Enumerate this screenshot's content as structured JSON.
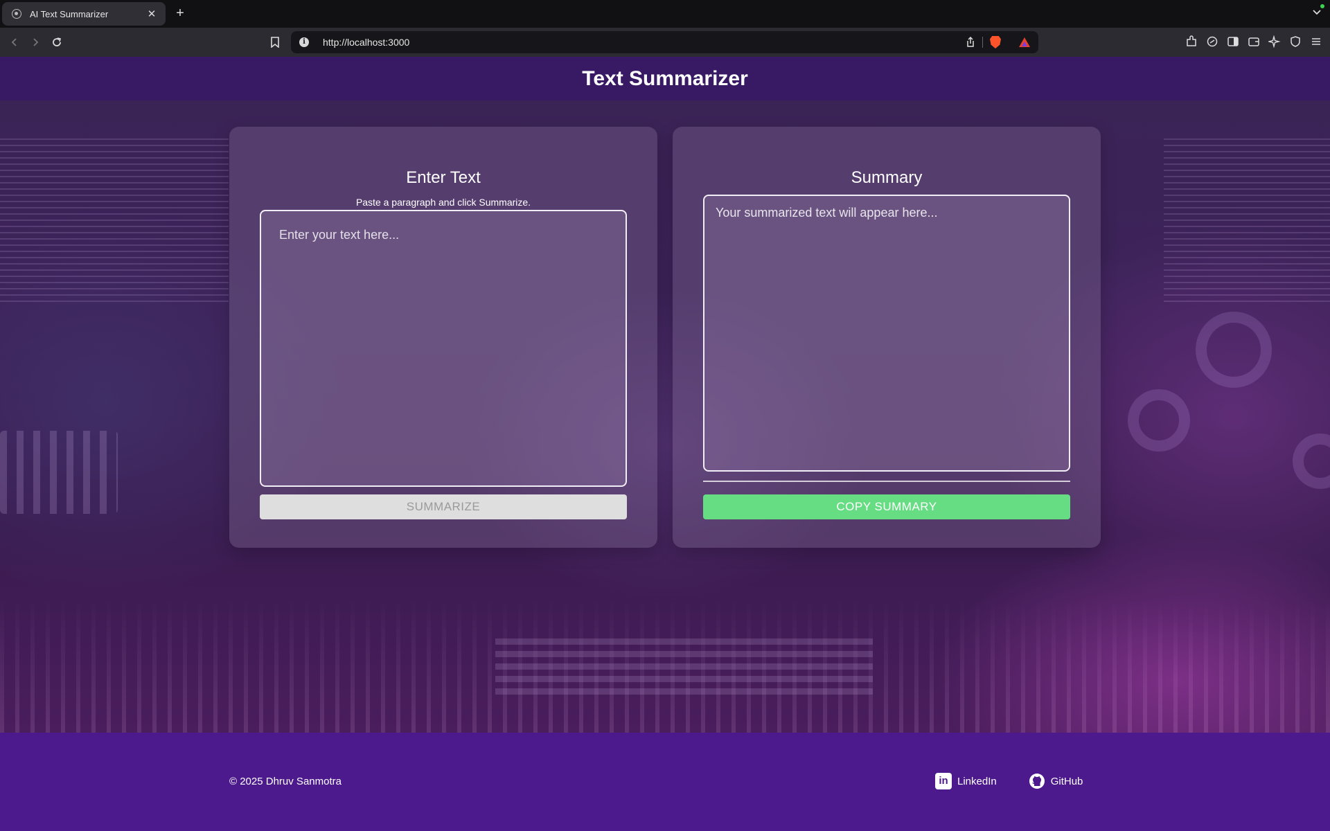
{
  "browser": {
    "tab_title": "AI Text Summarizer",
    "url": "http://localhost:3000"
  },
  "header": {
    "title": "Text Summarizer"
  },
  "input_panel": {
    "heading": "Enter Text",
    "subtitle": "Paste a paragraph and click Summarize.",
    "placeholder": "Enter your text here...",
    "button_label": "SUMMARIZE"
  },
  "summary_panel": {
    "heading": "Summary",
    "placeholder": "Your summarized text will appear here...",
    "button_label": "COPY SUMMARY"
  },
  "footer": {
    "copyright": "© 2025 Dhruv Sanmotra",
    "links": [
      {
        "label": "LinkedIn",
        "icon": "linkedin-icon"
      },
      {
        "label": "GitHub",
        "icon": "github-icon"
      }
    ]
  },
  "colors": {
    "header_bg": "#381868",
    "footer_bg": "#4c1a8c",
    "copy_button": "#66dd83",
    "summarize_button": "#dedede"
  }
}
